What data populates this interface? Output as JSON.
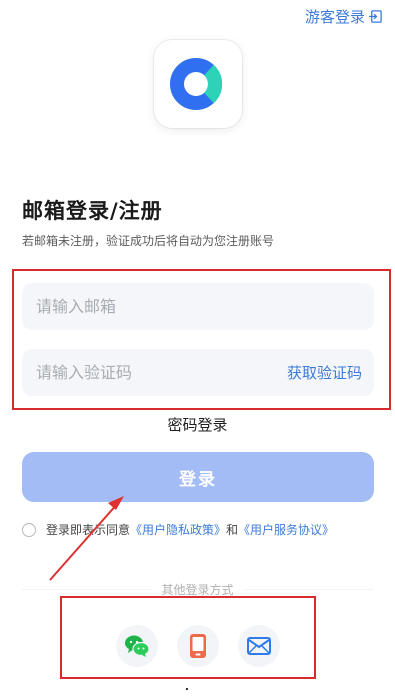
{
  "header": {
    "guest_login": "游客登录"
  },
  "app": {
    "logo_icon": "app-logo",
    "brand_color": "#3d7bd9"
  },
  "form": {
    "title": "邮箱登录/注册",
    "subtitle": "若邮箱未注册，验证成功后将自动为您注册账号",
    "email_placeholder": "请输入邮箱",
    "email_value": "",
    "code_placeholder": "请输入验证码",
    "code_value": "",
    "get_code_label": "获取验证码",
    "password_login_label": "密码登录",
    "login_button_label": "登录"
  },
  "agreement": {
    "prefix": "登录即表示同意",
    "privacy_link": "《用户隐私政策》",
    "and": "和",
    "service_link": "《用户服务协议》",
    "checked": false
  },
  "other_login": {
    "label": "其他登录方式",
    "methods": [
      "wechat-icon",
      "phone-icon",
      "mail-icon"
    ]
  },
  "annotation_color": "#d92b2b"
}
